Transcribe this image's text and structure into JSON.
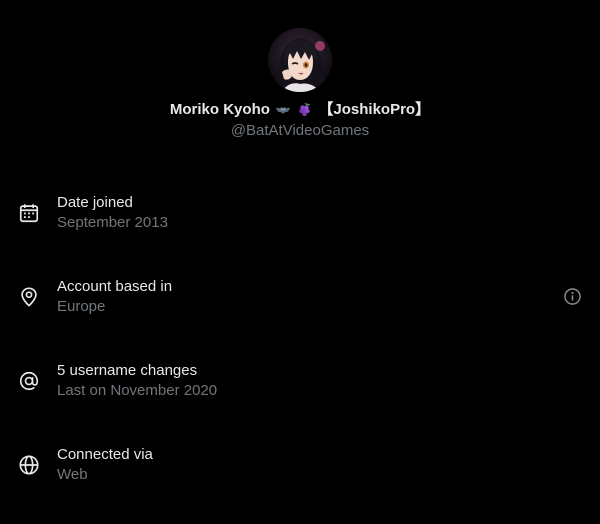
{
  "profile": {
    "display_name": "Moriko Kyoho",
    "display_name_suffix": "【JoshikoPro】",
    "name_emojis": [
      "bat-emoji",
      "grapes-emoji"
    ],
    "handle": "@BatAtVideoGames"
  },
  "about": {
    "rows": [
      {
        "icon": "calendar-icon",
        "label": "Date joined",
        "value": "September 2013"
      },
      {
        "icon": "location-pin-icon",
        "label": "Account based in",
        "value": "Europe",
        "has_info": true
      },
      {
        "icon": "at-sign-icon",
        "label": "5 username changes",
        "value": "Last on November 2020"
      },
      {
        "icon": "globe-icon",
        "label": "Connected via",
        "value": "Web"
      }
    ]
  },
  "colors": {
    "background": "#000000",
    "primary_text": "#e7e9ea",
    "secondary_text": "#71767b"
  }
}
